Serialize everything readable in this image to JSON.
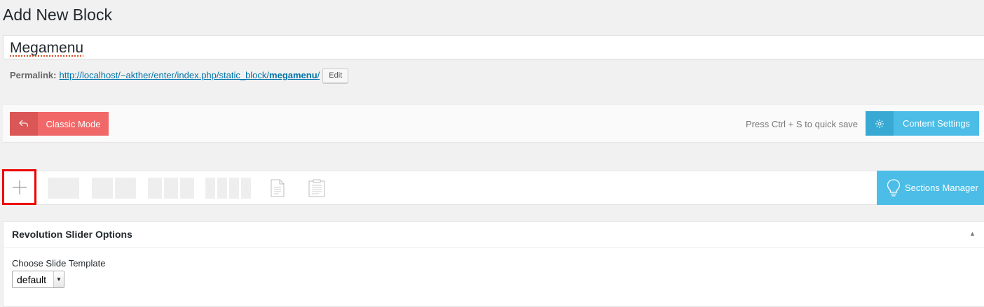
{
  "page": {
    "title": "Add New Block"
  },
  "post": {
    "title_value": "Megamenu"
  },
  "permalink": {
    "label": "Permalink:",
    "url_base": "http://localhost/~akther/enter/index.php/static_block/",
    "slug": "megamenu",
    "url_tail": "/",
    "edit_label": "Edit"
  },
  "builder": {
    "classic_mode_label": "Classic Mode",
    "quick_save_hint": "Press Ctrl + S to quick save",
    "content_settings_label": "Content Settings",
    "sections_manager_label": "Sections Manager",
    "toolbar_icons": [
      "plus-icon",
      "row-1-column-icon",
      "row-2-columns-icon",
      "row-3-columns-icon",
      "row-4-columns-icon",
      "text-block-icon",
      "templates-icon"
    ]
  },
  "metabox": {
    "title": "Revolution Slider Options",
    "field_label": "Choose Slide Template",
    "select_value": "default"
  },
  "colors": {
    "classic_mode": "#f06868",
    "accent_blue": "#4bbde6",
    "highlight_box": "#ee0000",
    "link": "#0073aa"
  }
}
